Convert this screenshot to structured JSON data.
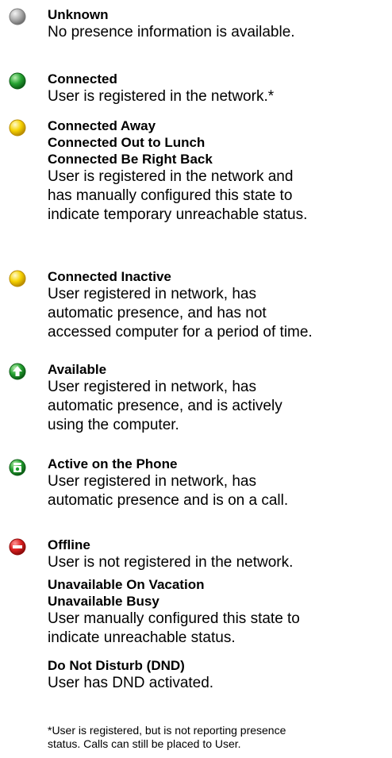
{
  "legend": {
    "unknown": {
      "title": "Unknown",
      "desc": "No presence information is available.",
      "icon": "gray-sphere-icon",
      "color": "#9a9a9a"
    },
    "connected": {
      "title": "Connected",
      "desc": "User is registered in the network.*",
      "icon": "green-sphere-icon",
      "color": "#1f9e2e"
    },
    "connected_away": {
      "titles": [
        "Connected Away",
        "Connected Out to Lunch",
        "Connected Be Right Back"
      ],
      "desc_lines": [
        "User is registered in the network and",
        "has manually configured this state to",
        "indicate temporary unreachable status."
      ],
      "icon": "yellow-sphere-icon",
      "color": "#f2cc00"
    },
    "connected_inactive": {
      "title": "Connected Inactive",
      "desc_lines": [
        "User registered in network, has",
        "automatic presence, and has not",
        "accessed computer for a period of time."
      ],
      "icon": "yellow-sphere-icon",
      "color": "#f2cc00"
    },
    "available": {
      "title": "Available",
      "desc_lines": [
        "User registered in network, has",
        "automatic presence, and is actively",
        "using the computer."
      ],
      "icon": "green-up-arrow-icon",
      "color": "#1f9e2e"
    },
    "active_phone": {
      "title": "Active on the Phone",
      "desc_lines": [
        "User registered in network, has",
        "automatic presence and is on a call."
      ],
      "icon": "green-phone-icon",
      "color": "#1f9e2e"
    },
    "offline": {
      "title": "Offline",
      "desc": "User is not registered in the network.",
      "icon": "red-no-entry-icon",
      "color": "#d81e1e",
      "sub1_titles": [
        "Unavailable On Vacation",
        "Unavailable Busy"
      ],
      "sub1_desc_lines": [
        "User manually configured this state to",
        "indicate unreachable status."
      ],
      "sub2_title": "Do Not Disturb (DND)",
      "sub2_desc": "User has DND activated."
    },
    "footnote_lines": [
      "*User is registered, but is not reporting presence",
      "status.  Calls can still be placed to User."
    ]
  }
}
